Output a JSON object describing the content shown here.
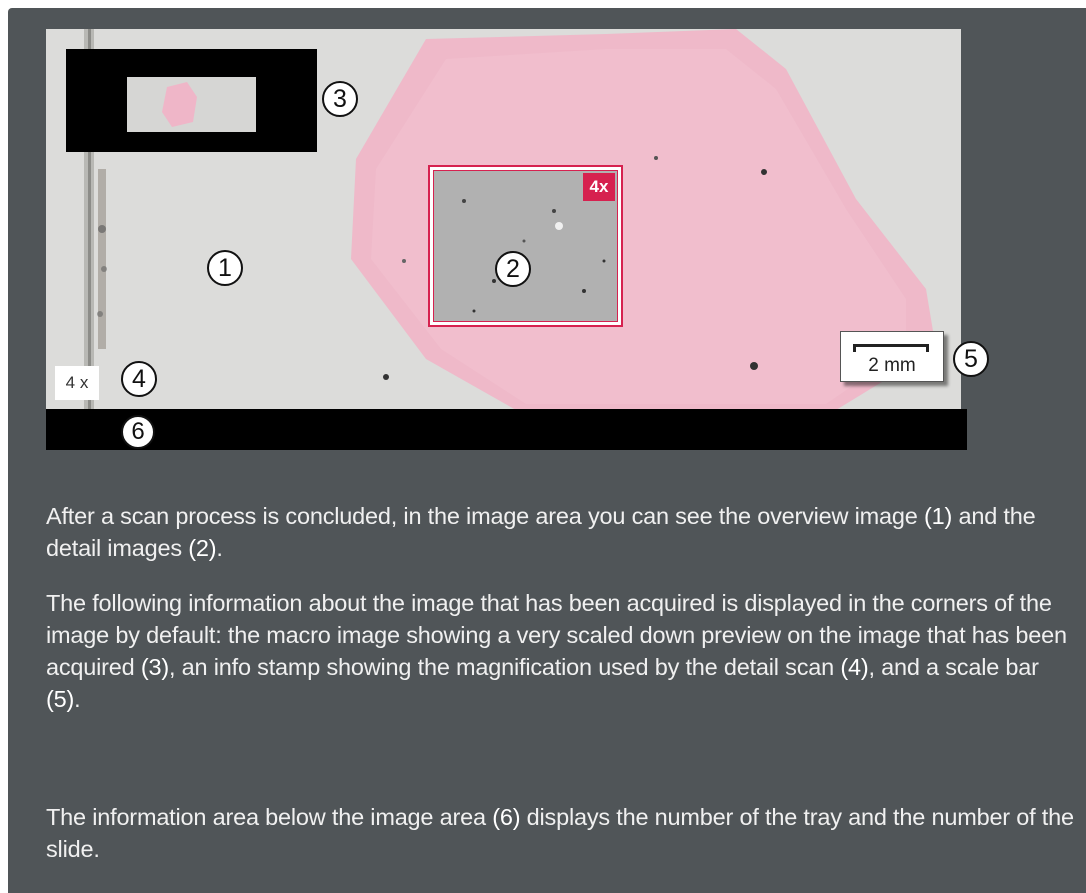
{
  "figure": {
    "callouts": [
      "1",
      "2",
      "3",
      "4",
      "5",
      "6"
    ],
    "detail_magnification_badge": "4x",
    "info_stamp": "4 x",
    "scale_bar_label": "2 mm"
  },
  "paragraphs": [
    {
      "parts": [
        "After a scan process is concluded, in the image area you can see the overview image ",
        "(1)",
        " and the detail images ",
        "(2)",
        "."
      ]
    },
    {
      "parts": [
        "The following information about the image that has been acquired is displayed in the corners of the image by default: the macro image showing a very scaled down preview on the image that has been acquired ",
        "(3)",
        ", an info stamp showing the magnification used by the detail scan ",
        "(4)",
        ", and a scale bar ",
        "(5)",
        "."
      ]
    },
    {
      "parts": [
        "The information area below the image area ",
        "(6)",
        " displays the number of the tray and the number of the slide."
      ]
    }
  ],
  "colors": {
    "panel_background": "#505558",
    "accent_red": "#d6214f",
    "tissue_pink": "#efb6c8",
    "text": "#f0f0f0"
  }
}
